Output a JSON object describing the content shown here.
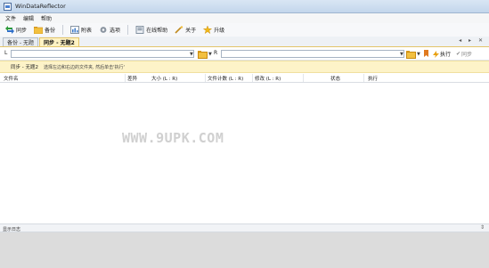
{
  "window": {
    "title": "WinDataReflector"
  },
  "menu": {
    "items": [
      "文件",
      "编辑",
      "帮助"
    ]
  },
  "toolbar": {
    "sync_label": "同步",
    "backup_label": "备份",
    "report_label": "附表",
    "options_label": "选项",
    "help_label": "在线帮助",
    "about_label": "关于",
    "upgrade_label": "升级"
  },
  "tabs": [
    {
      "label": "备份 - 无题"
    },
    {
      "label": "同步 - 无题2"
    }
  ],
  "tab_nav": "◂ ▸ ✕",
  "paths": {
    "left_label": "L",
    "right_label": "R",
    "left_value": "",
    "right_value": "",
    "execute_label": "执行",
    "sync_label": "同步"
  },
  "notice": {
    "title": "同步 - 无题2",
    "hint": "选择左边和右边的文件夹, 然后单击'执行'"
  },
  "columns": [
    "文件名",
    "差异",
    "大小 (L : R)",
    "文件计数 (L : R)",
    "修改 (L : R)",
    "状态",
    "执行"
  ],
  "watermark": "WWW.9UPK.COM",
  "log": {
    "title": "显示日志",
    "pin": "⇕"
  },
  "colors": {
    "accent_tab": "#fff3c4",
    "notice_bg": "#fdf3c8",
    "log_bg": "#dcdcdc"
  }
}
